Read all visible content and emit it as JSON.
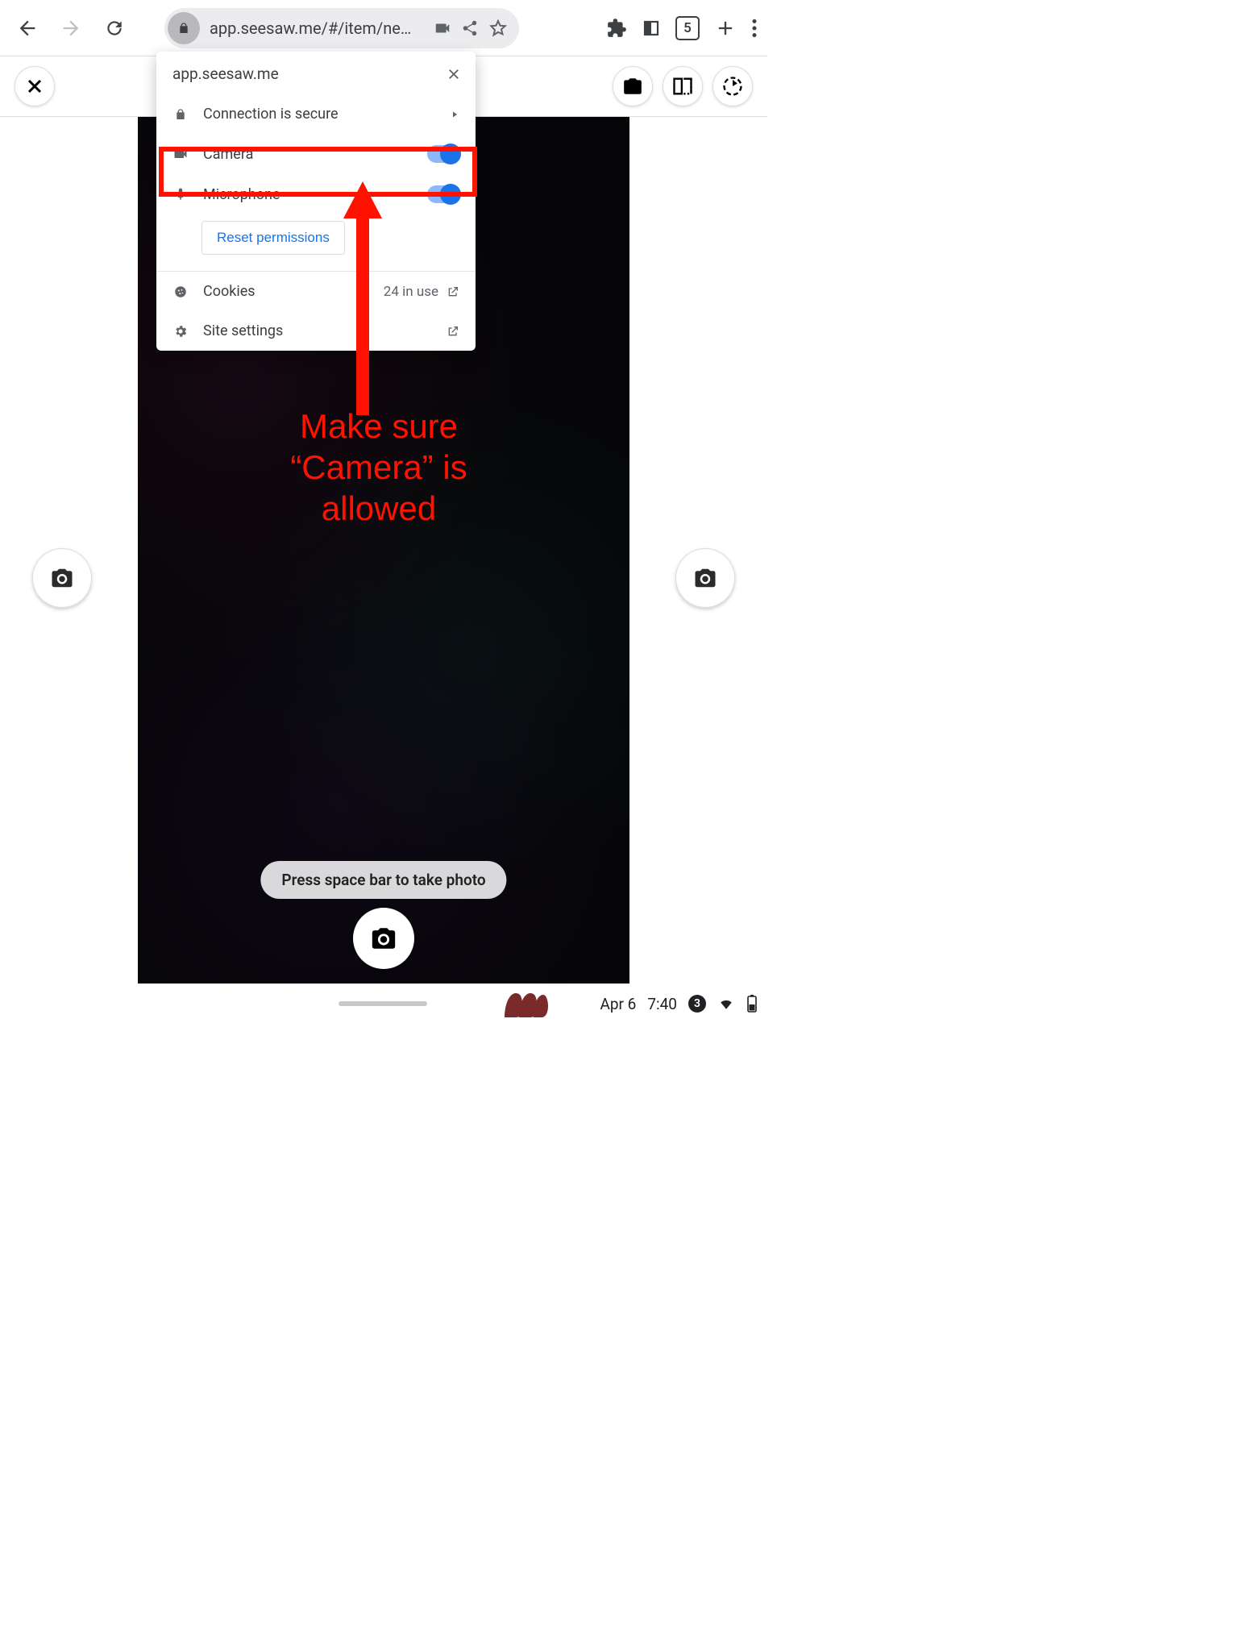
{
  "browser": {
    "url": "app.seesaw.me/#/item/ne…",
    "tab_count": "5"
  },
  "site_info": {
    "host": "app.seesaw.me",
    "connection": "Connection is secure",
    "camera": "Camera",
    "microphone": "Microphone",
    "reset": "Reset permissions",
    "cookies": "Cookies",
    "cookies_inuse": "24 in use",
    "site_settings": "Site settings"
  },
  "camera_ui": {
    "hint": "Press space bar to take photo"
  },
  "annotation": {
    "text": "Make sure “Camera” is allowed"
  },
  "shelf": {
    "date": "Apr 6",
    "time": "7:40",
    "notif_count": "3"
  }
}
